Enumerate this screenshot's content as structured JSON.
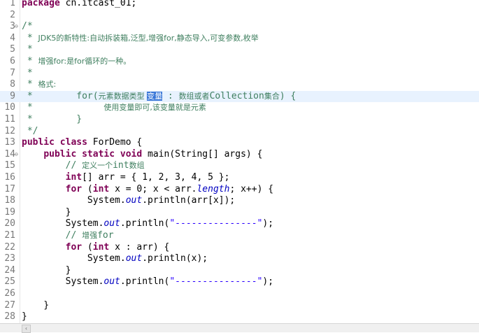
{
  "editor": {
    "lines": [
      {
        "n": "1",
        "parts": [
          {
            "t": "package",
            "c": "kw"
          },
          {
            "t": " cn.itcast_01;",
            "c": ""
          }
        ]
      },
      {
        "n": "2",
        "parts": []
      },
      {
        "n": "3",
        "fold": true,
        "parts": [
          {
            "t": "/*",
            "c": "cm"
          }
        ]
      },
      {
        "n": "4",
        "parts": [
          {
            "t": " * ",
            "c": "cm"
          },
          {
            "t": "JDK5的新特性:自动拆装箱,泛型,增强for,静态导入,可变参数,枚举",
            "c": "cm cn"
          }
        ]
      },
      {
        "n": "5",
        "parts": [
          {
            "t": " *",
            "c": "cm"
          }
        ]
      },
      {
        "n": "6",
        "parts": [
          {
            "t": " * ",
            "c": "cm"
          },
          {
            "t": "增强for:是for循环的一种。",
            "c": "cm cn"
          }
        ]
      },
      {
        "n": "7",
        "parts": [
          {
            "t": " *",
            "c": "cm"
          }
        ]
      },
      {
        "n": "8",
        "parts": [
          {
            "t": " * ",
            "c": "cm"
          },
          {
            "t": "格式:",
            "c": "cm cn"
          }
        ]
      },
      {
        "n": "9",
        "current": true,
        "parts": [
          {
            "t": " *        for(",
            "c": "cm"
          },
          {
            "t": "元素数据类型 ",
            "c": "cm cn"
          },
          {
            "t": "变量",
            "c": "sel cn"
          },
          {
            "t": " : ",
            "c": "cm"
          },
          {
            "t": "数组或者",
            "c": "cm cn"
          },
          {
            "t": "Collection",
            "c": "cm"
          },
          {
            "t": "集合",
            "c": "cm cn"
          },
          {
            "t": ") {",
            "c": "cm"
          }
        ]
      },
      {
        "n": "10",
        "parts": [
          {
            "t": " *             ",
            "c": "cm"
          },
          {
            "t": "使用变量即可,该变量就是元素",
            "c": "cm cn"
          }
        ]
      },
      {
        "n": "11",
        "parts": [
          {
            "t": " *        }",
            "c": "cm"
          }
        ]
      },
      {
        "n": "12",
        "parts": [
          {
            "t": " */",
            "c": "cm"
          }
        ]
      },
      {
        "n": "13",
        "parts": [
          {
            "t": "public class",
            "c": "kw"
          },
          {
            "t": " ForDemo {",
            "c": ""
          }
        ]
      },
      {
        "n": "14",
        "fold": true,
        "parts": [
          {
            "t": "    ",
            "c": ""
          },
          {
            "t": "public static void",
            "c": "kw"
          },
          {
            "t": " main(String[] args) {",
            "c": ""
          }
        ]
      },
      {
        "n": "15",
        "parts": [
          {
            "t": "        // ",
            "c": "cm"
          },
          {
            "t": "定义一个",
            "c": "cm cn"
          },
          {
            "t": "int",
            "c": "cm"
          },
          {
            "t": "数组",
            "c": "cm cn"
          }
        ]
      },
      {
        "n": "16",
        "parts": [
          {
            "t": "        ",
            "c": ""
          },
          {
            "t": "int",
            "c": "kw"
          },
          {
            "t": "[] arr = { 1, 2, 3, 4, 5 };",
            "c": ""
          }
        ]
      },
      {
        "n": "17",
        "parts": [
          {
            "t": "        ",
            "c": ""
          },
          {
            "t": "for",
            "c": "kw"
          },
          {
            "t": " (",
            "c": ""
          },
          {
            "t": "int",
            "c": "kw"
          },
          {
            "t": " x = 0; x < arr.",
            "c": ""
          },
          {
            "t": "length",
            "c": "field"
          },
          {
            "t": "; x++) {",
            "c": ""
          }
        ]
      },
      {
        "n": "18",
        "parts": [
          {
            "t": "            System.",
            "c": ""
          },
          {
            "t": "out",
            "c": "field"
          },
          {
            "t": ".println(arr[x]);",
            "c": ""
          }
        ]
      },
      {
        "n": "19",
        "parts": [
          {
            "t": "        }",
            "c": ""
          }
        ]
      },
      {
        "n": "20",
        "parts": [
          {
            "t": "        System.",
            "c": ""
          },
          {
            "t": "out",
            "c": "field"
          },
          {
            "t": ".println(",
            "c": ""
          },
          {
            "t": "\"---------------\"",
            "c": "str"
          },
          {
            "t": ");",
            "c": ""
          }
        ]
      },
      {
        "n": "21",
        "parts": [
          {
            "t": "        // ",
            "c": "cm"
          },
          {
            "t": "增强",
            "c": "cm cn"
          },
          {
            "t": "for",
            "c": "cm"
          }
        ]
      },
      {
        "n": "22",
        "parts": [
          {
            "t": "        ",
            "c": ""
          },
          {
            "t": "for",
            "c": "kw"
          },
          {
            "t": " (",
            "c": ""
          },
          {
            "t": "int",
            "c": "kw"
          },
          {
            "t": " x : arr) {",
            "c": ""
          }
        ]
      },
      {
        "n": "23",
        "parts": [
          {
            "t": "            System.",
            "c": ""
          },
          {
            "t": "out",
            "c": "field"
          },
          {
            "t": ".println(x);",
            "c": ""
          }
        ]
      },
      {
        "n": "24",
        "parts": [
          {
            "t": "        }",
            "c": ""
          }
        ]
      },
      {
        "n": "25",
        "parts": [
          {
            "t": "        System.",
            "c": ""
          },
          {
            "t": "out",
            "c": "field"
          },
          {
            "t": ".println(",
            "c": ""
          },
          {
            "t": "\"---------------\"",
            "c": "str"
          },
          {
            "t": ");",
            "c": ""
          }
        ]
      },
      {
        "n": "26",
        "parts": []
      },
      {
        "n": "27",
        "parts": [
          {
            "t": "    }",
            "c": ""
          }
        ]
      },
      {
        "n": "28",
        "parts": [
          {
            "t": "}",
            "c": ""
          }
        ]
      }
    ],
    "fold_glyph": "⊖",
    "scroll_left_glyph": "‹"
  }
}
